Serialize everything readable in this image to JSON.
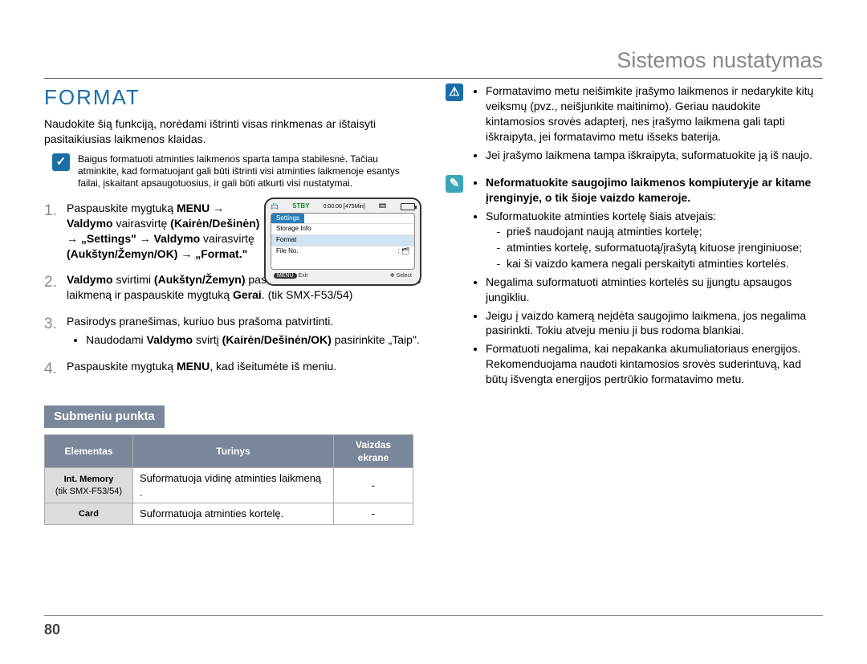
{
  "header": {
    "section": "Sistemos nustatymas"
  },
  "left": {
    "title": "FORMAT",
    "intro": "Naudokite šią funkciją, norėdami ištrinti visas rinkmenas ar ištaisyti pasitaikiusias laikmenos klaidas.",
    "note1": "Baigus formatuoti atminties laikmenos sparta tampa stabilesnė. Tačiau atminkite, kad formatuojant gali būti ištrinti visi atminties laikmenoje esantys failai, įskaitant apsaugotuosius, ir gali būti atkurti visi nustatymai.",
    "steps": {
      "s1": {
        "num": "1.",
        "plain_a": "Paspauskite mygtuką ",
        "bold_menu": "MENU",
        "arrow": " → ",
        "bold_valdymo": "Valdymo",
        "plain_vair": " vairasvirtę ",
        "bold_kairen": "(Kairėn/Dešinėn)",
        "arrow2": " → ",
        "bold_settings": "„Settings\"",
        "arrow3": " → ",
        "bold_valdymo2": "Valdymo",
        "plain_vair2": " vairasvirtę ",
        "bold_auz": "(Aukštyn/Žemyn/OK)",
        "arrow4": " → ",
        "bold_format": "„Format.\""
      },
      "s2": {
        "num": "2.",
        "bold_valdymo": "Valdymo",
        "plain_svirtimi": " svirtimi ",
        "bold_auz": "(Aukštyn/Žemyn)",
        "plain_pasirinkite": " pasirinkite pageidaujamą atminties laikmeną ir paspauskite mygtuką ",
        "bold_gerai": "Gerai",
        "plain_tik": ". (tik SMX-F53/54)"
      },
      "s3": {
        "num": "3.",
        "text": "Pasirodys pranešimas, kuriuo bus prašoma patvirtinti.",
        "bullet_a": "Naudodami ",
        "bullet_bold_v": "Valdymo",
        "bullet_b": " svirtį ",
        "bullet_bold_k": "(Kairėn/Dešinėn/OK)",
        "bullet_c": " pasirinkite „Taip\"."
      },
      "s4": {
        "num": "4.",
        "plain_a": "Paspauskite mygtuką ",
        "bold_menu": "MENU",
        "plain_b": ", kad išeitumėte iš meniu."
      }
    },
    "lcd": {
      "stby": "STBY",
      "time": "0:00:00 [475Min]",
      "tab": "Settings",
      "row1": "Storage Info",
      "row2": "Format",
      "row3": "File No.",
      "exit": "Exit",
      "select": "Select",
      "btn_menu": "MENU"
    },
    "submeniu": {
      "title": "Submeniu punkta",
      "headers": {
        "h1": "Elementas",
        "h2": "Turinys",
        "h3": "Vaizdas ekrane"
      },
      "rows": [
        {
          "item": "Int. Memory",
          "item2": "(tik SMX-F53/54)",
          "content": "Suformatuoja vidinę atminties laikmeną .",
          "display": "-"
        },
        {
          "item": "Card",
          "item2": "",
          "content": "Suformatuoja atminties kortelę.",
          "display": "-"
        }
      ]
    }
  },
  "right": {
    "warn": [
      "Formatavimo metu neišimkite įrašymo laikmenos ir nedarykite kitų veiksmų (pvz., neišjunkite maitinimo). Geriau naudokite kintamosios srovės adapterį, nes įrašymo laikmena gali tapti iškraipyta, jei formatavimo metu išseks baterija.",
      "Jei įrašymo laikmena tampa iškraipyta, suformatuokite ją iš naujo."
    ],
    "info": {
      "lead_bold": "Neformatuokite saugojimo laikmenos kompiuteryje ar kitame įrenginyje, o tik šioje vaizdo kameroje.",
      "items": [
        {
          "text": "Suformatuokite atminties kortelę šiais atvejais:",
          "sub": [
            "prieš naudojant naują atminties kortelę;",
            "atminties kortelę, suformatuotą/įrašytą kituose įrenginiuose;",
            "kai ši vaizdo kamera negali perskaityti atminties kortelės."
          ]
        },
        {
          "text": "Negalima suformatuoti atminties kortelės su įjungtu apsaugos jungikliu.",
          "sub": []
        },
        {
          "text": "Jeigu į vaizdo kamerą neįdėta saugojimo laikmena, jos negalima pasirinkti. Tokiu atveju meniu ji bus rodoma blankiai.",
          "sub": []
        },
        {
          "text": "Formatuoti negalima, kai nepakanka akumuliatoriaus energijos. Rekomenduojama naudoti kintamosios srovės suderintuvą, kad būtų išvengta energijos pertrūkio formatavimo metu.",
          "sub": []
        }
      ]
    }
  },
  "page": "80"
}
